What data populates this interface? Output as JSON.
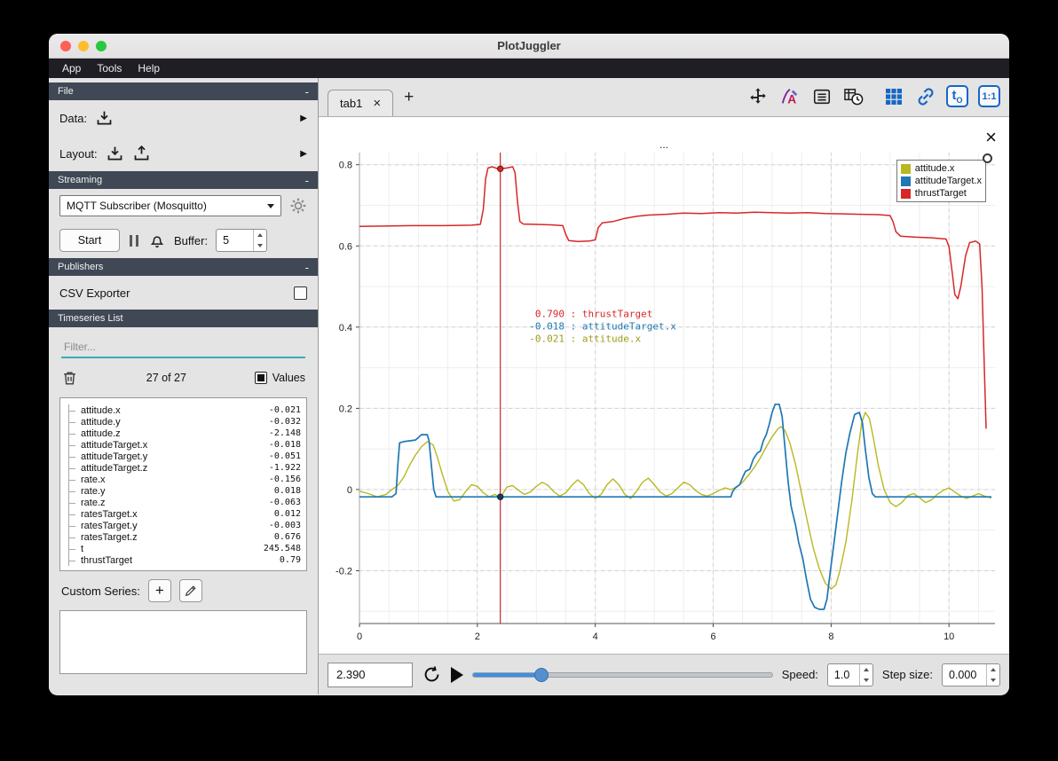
{
  "window": {
    "title": "PlotJuggler"
  },
  "menubar": {
    "items": [
      "App",
      "Tools",
      "Help"
    ]
  },
  "sidebar": {
    "file": {
      "title": "File",
      "collapse": "-",
      "data_label": "Data:",
      "layout_label": "Layout:"
    },
    "streaming": {
      "title": "Streaming",
      "collapse": "-",
      "source": "MQTT Subscriber (Mosquitto)",
      "start_label": "Start",
      "buffer_label": "Buffer:",
      "buffer_value": "5"
    },
    "publishers": {
      "title": "Publishers",
      "collapse": "-",
      "csv_label": "CSV Exporter"
    },
    "timeseries": {
      "title": "Timeseries List",
      "filter_placeholder": "Filter...",
      "count_label": "27 of 27",
      "values_label": "Values",
      "custom_series_label": "Custom Series:",
      "add_label": "+",
      "items": [
        {
          "name": "attitude.x",
          "value": "-0.021"
        },
        {
          "name": "attitude.y",
          "value": "-0.032"
        },
        {
          "name": "attitude.z",
          "value": "-2.148"
        },
        {
          "name": "attitudeTarget.x",
          "value": "-0.018"
        },
        {
          "name": "attitudeTarget.y",
          "value": "-0.051"
        },
        {
          "name": "attitudeTarget.z",
          "value": "-1.922"
        },
        {
          "name": "rate.x",
          "value": "-0.156"
        },
        {
          "name": "rate.y",
          "value": "0.018"
        },
        {
          "name": "rate.z",
          "value": "-0.063"
        },
        {
          "name": "ratesTarget.x",
          "value": "0.012"
        },
        {
          "name": "ratesTarget.y",
          "value": "-0.003"
        },
        {
          "name": "ratesTarget.z",
          "value": "0.676"
        },
        {
          "name": "t",
          "value": "245.548"
        },
        {
          "name": "thrustTarget",
          "value": "0.79"
        }
      ]
    }
  },
  "tabbar": {
    "tab_label": "tab1",
    "close_label": "×",
    "add_label": "+",
    "t0_label": "t",
    "t0_sub": "O",
    "ratio_label": "1:1"
  },
  "plot": {
    "title": "...",
    "close_label": "×"
  },
  "playback": {
    "time_value": "2.390",
    "speed_label": "Speed:",
    "speed_value": "1.0",
    "step_label": "Step size:",
    "step_value": "0.000",
    "slider_fraction": 0.23
  },
  "colors": {
    "accent_blue": "#1866c4",
    "tracker_red": "#c00000",
    "filter_underline": "#3aacb8",
    "series_yellow": "#b8b821",
    "series_blue": "#1f77b4",
    "series_red": "#d62728"
  },
  "chart_data": {
    "type": "line",
    "title": "...",
    "xlabel": "",
    "ylabel": "",
    "xlim": [
      0,
      10.78
    ],
    "ylim": [
      -0.33,
      0.83
    ],
    "grid": true,
    "legend_position": "top-right",
    "x_ticks": {
      "values": [
        0,
        2,
        4,
        6,
        8,
        10
      ],
      "labels": [
        "0",
        "2",
        "4",
        "6",
        "8",
        "10"
      ]
    },
    "y_ticks": {
      "values": [
        -0.2,
        0,
        0.2,
        0.4,
        0.6,
        0.8
      ],
      "labels": [
        "-0.2",
        "0",
        "0.2",
        "0.4",
        "0.6",
        "0.8"
      ]
    },
    "x_minor_step": 0.5,
    "y_minor_step": 0.1,
    "tracker": {
      "x": 2.39,
      "label_anchor": [
        2.88,
        0.425
      ],
      "lines": [
        {
          "value": " 0.790",
          "name": "thrustTarget",
          "color": "#d62728"
        },
        {
          "value": "-0.018",
          "name": "attitudeTarget.x",
          "color": "#1f77b4"
        },
        {
          "value": "-0.021",
          "name": "attitude.x",
          "color": "#9c9d1d"
        }
      ],
      "dots": [
        {
          "x": 2.39,
          "y": 0.79,
          "fill": "#d62728",
          "edge": "#7a1010"
        },
        {
          "x": 2.39,
          "y": -0.018,
          "fill": "#173a5e",
          "edge": "#0d2236"
        }
      ]
    },
    "series": [
      {
        "name": "attitude.x",
        "color": "#b8b821",
        "width": 1.4,
        "points": [
          [
            0,
            -0.004
          ],
          [
            0.15,
            -0.01
          ],
          [
            0.3,
            -0.018
          ],
          [
            0.45,
            -0.012
          ],
          [
            0.55,
            0
          ],
          [
            0.65,
            0.01
          ],
          [
            0.75,
            0.03
          ],
          [
            0.85,
            0.06
          ],
          [
            0.95,
            0.085
          ],
          [
            1.05,
            0.105
          ],
          [
            1.15,
            0.118
          ],
          [
            1.25,
            0.11
          ],
          [
            1.32,
            0.08
          ],
          [
            1.4,
            0.04
          ],
          [
            1.5,
            -0.005
          ],
          [
            1.6,
            -0.028
          ],
          [
            1.7,
            -0.025
          ],
          [
            1.8,
            -0.005
          ],
          [
            1.9,
            0.012
          ],
          [
            2.0,
            0.008
          ],
          [
            2.1,
            -0.008
          ],
          [
            2.2,
            -0.018
          ],
          [
            2.3,
            -0.012
          ],
          [
            2.39,
            -0.021
          ],
          [
            2.5,
            0.006
          ],
          [
            2.6,
            0.01
          ],
          [
            2.7,
            -0.002
          ],
          [
            2.8,
            -0.012
          ],
          [
            2.9,
            -0.006
          ],
          [
            3.0,
            0.008
          ],
          [
            3.1,
            0.018
          ],
          [
            3.2,
            0.01
          ],
          [
            3.3,
            -0.006
          ],
          [
            3.4,
            -0.016
          ],
          [
            3.5,
            -0.008
          ],
          [
            3.6,
            0.01
          ],
          [
            3.7,
            0.024
          ],
          [
            3.8,
            0.012
          ],
          [
            3.9,
            -0.01
          ],
          [
            4.0,
            -0.022
          ],
          [
            4.1,
            -0.012
          ],
          [
            4.2,
            0.012
          ],
          [
            4.3,
            0.026
          ],
          [
            4.4,
            0.012
          ],
          [
            4.5,
            -0.012
          ],
          [
            4.6,
            -0.022
          ],
          [
            4.7,
            -0.004
          ],
          [
            4.8,
            0.018
          ],
          [
            4.9,
            0.028
          ],
          [
            5.0,
            0.012
          ],
          [
            5.1,
            -0.006
          ],
          [
            5.2,
            -0.016
          ],
          [
            5.3,
            -0.01
          ],
          [
            5.4,
            0.004
          ],
          [
            5.5,
            0.018
          ],
          [
            5.6,
            0.012
          ],
          [
            5.7,
            -0.002
          ],
          [
            5.8,
            -0.012
          ],
          [
            5.9,
            -0.016
          ],
          [
            6.0,
            -0.01
          ],
          [
            6.1,
            -0.002
          ],
          [
            6.2,
            0.004
          ],
          [
            6.3,
            0
          ],
          [
            6.4,
            0.006
          ],
          [
            6.5,
            0.018
          ],
          [
            6.6,
            0.036
          ],
          [
            6.7,
            0.055
          ],
          [
            6.8,
            0.078
          ],
          [
            6.9,
            0.105
          ],
          [
            7.0,
            0.13
          ],
          [
            7.1,
            0.15
          ],
          [
            7.15,
            0.155
          ],
          [
            7.22,
            0.145
          ],
          [
            7.3,
            0.115
          ],
          [
            7.4,
            0.06
          ],
          [
            7.5,
            -0.01
          ],
          [
            7.6,
            -0.08
          ],
          [
            7.7,
            -0.145
          ],
          [
            7.8,
            -0.195
          ],
          [
            7.9,
            -0.23
          ],
          [
            8.0,
            -0.245
          ],
          [
            8.08,
            -0.235
          ],
          [
            8.15,
            -0.2
          ],
          [
            8.25,
            -0.13
          ],
          [
            8.35,
            -0.03
          ],
          [
            8.45,
            0.09
          ],
          [
            8.52,
            0.165
          ],
          [
            8.58,
            0.19
          ],
          [
            8.65,
            0.175
          ],
          [
            8.72,
            0.125
          ],
          [
            8.8,
            0.06
          ],
          [
            8.9,
            0
          ],
          [
            9.0,
            -0.032
          ],
          [
            9.1,
            -0.042
          ],
          [
            9.2,
            -0.032
          ],
          [
            9.3,
            -0.015
          ],
          [
            9.4,
            -0.01
          ],
          [
            9.5,
            -0.02
          ],
          [
            9.6,
            -0.032
          ],
          [
            9.7,
            -0.026
          ],
          [
            9.8,
            -0.012
          ],
          [
            9.9,
            -0.002
          ],
          [
            10.0,
            0.004
          ],
          [
            10.1,
            -0.006
          ],
          [
            10.2,
            -0.016
          ],
          [
            10.3,
            -0.022
          ],
          [
            10.4,
            -0.016
          ],
          [
            10.5,
            -0.01
          ],
          [
            10.6,
            -0.016
          ],
          [
            10.72,
            -0.021
          ]
        ]
      },
      {
        "name": "attitudeTarget.x",
        "color": "#1f77b4",
        "width": 1.7,
        "points": [
          [
            0,
            -0.018
          ],
          [
            0.55,
            -0.018
          ],
          [
            0.62,
            -0.01
          ],
          [
            0.65,
            0.06
          ],
          [
            0.68,
            0.115
          ],
          [
            0.75,
            0.118
          ],
          [
            0.85,
            0.12
          ],
          [
            0.95,
            0.122
          ],
          [
            1.0,
            0.128
          ],
          [
            1.05,
            0.135
          ],
          [
            1.15,
            0.135
          ],
          [
            1.18,
            0.12
          ],
          [
            1.22,
            0.06
          ],
          [
            1.26,
            0
          ],
          [
            1.3,
            -0.018
          ],
          [
            2.0,
            -0.018
          ],
          [
            3.0,
            -0.018
          ],
          [
            4.0,
            -0.018
          ],
          [
            5.0,
            -0.018
          ],
          [
            6.0,
            -0.018
          ],
          [
            6.3,
            -0.018
          ],
          [
            6.33,
            -0.005
          ],
          [
            6.38,
            0.005
          ],
          [
            6.45,
            0.012
          ],
          [
            6.5,
            0.03
          ],
          [
            6.55,
            0.045
          ],
          [
            6.62,
            0.05
          ],
          [
            6.68,
            0.075
          ],
          [
            6.75,
            0.09
          ],
          [
            6.8,
            0.095
          ],
          [
            6.85,
            0.12
          ],
          [
            6.9,
            0.135
          ],
          [
            6.95,
            0.16
          ],
          [
            7.0,
            0.19
          ],
          [
            7.05,
            0.21
          ],
          [
            7.12,
            0.21
          ],
          [
            7.17,
            0.18
          ],
          [
            7.22,
            0.1
          ],
          [
            7.27,
            0.02
          ],
          [
            7.32,
            -0.04
          ],
          [
            7.4,
            -0.09
          ],
          [
            7.45,
            -0.13
          ],
          [
            7.52,
            -0.17
          ],
          [
            7.58,
            -0.22
          ],
          [
            7.65,
            -0.27
          ],
          [
            7.72,
            -0.29
          ],
          [
            7.8,
            -0.295
          ],
          [
            7.88,
            -0.295
          ],
          [
            7.93,
            -0.27
          ],
          [
            7.98,
            -0.21
          ],
          [
            8.05,
            -0.13
          ],
          [
            8.12,
            -0.05
          ],
          [
            8.18,
            0.02
          ],
          [
            8.25,
            0.09
          ],
          [
            8.32,
            0.14
          ],
          [
            8.4,
            0.185
          ],
          [
            8.48,
            0.19
          ],
          [
            8.53,
            0.165
          ],
          [
            8.58,
            0.1
          ],
          [
            8.64,
            0.03
          ],
          [
            8.7,
            -0.01
          ],
          [
            8.75,
            -0.018
          ],
          [
            9.5,
            -0.018
          ],
          [
            10.3,
            -0.018
          ],
          [
            10.72,
            -0.018
          ]
        ]
      },
      {
        "name": "thrustTarget",
        "color": "#d62728",
        "width": 1.5,
        "points": [
          [
            0,
            0.648
          ],
          [
            0.4,
            0.649
          ],
          [
            0.9,
            0.65
          ],
          [
            1.4,
            0.65
          ],
          [
            1.9,
            0.651
          ],
          [
            2.05,
            0.653
          ],
          [
            2.1,
            0.69
          ],
          [
            2.14,
            0.765
          ],
          [
            2.18,
            0.792
          ],
          [
            2.25,
            0.795
          ],
          [
            2.35,
            0.79
          ],
          [
            2.39,
            0.79
          ],
          [
            2.5,
            0.792
          ],
          [
            2.6,
            0.795
          ],
          [
            2.64,
            0.78
          ],
          [
            2.68,
            0.71
          ],
          [
            2.72,
            0.66
          ],
          [
            2.78,
            0.654
          ],
          [
            3.0,
            0.653
          ],
          [
            3.25,
            0.652
          ],
          [
            3.45,
            0.65
          ],
          [
            3.5,
            0.628
          ],
          [
            3.55,
            0.613
          ],
          [
            3.7,
            0.611
          ],
          [
            3.9,
            0.612
          ],
          [
            4.0,
            0.615
          ],
          [
            4.05,
            0.645
          ],
          [
            4.12,
            0.657
          ],
          [
            4.3,
            0.66
          ],
          [
            4.5,
            0.668
          ],
          [
            4.7,
            0.673
          ],
          [
            4.9,
            0.676
          ],
          [
            5.2,
            0.678
          ],
          [
            5.5,
            0.681
          ],
          [
            5.8,
            0.68
          ],
          [
            6.1,
            0.682
          ],
          [
            6.4,
            0.681
          ],
          [
            6.7,
            0.683
          ],
          [
            7.0,
            0.682
          ],
          [
            7.3,
            0.681
          ],
          [
            7.6,
            0.682
          ],
          [
            7.9,
            0.68
          ],
          [
            8.2,
            0.679
          ],
          [
            8.5,
            0.678
          ],
          [
            8.8,
            0.677
          ],
          [
            9.0,
            0.675
          ],
          [
            9.05,
            0.66
          ],
          [
            9.1,
            0.635
          ],
          [
            9.18,
            0.624
          ],
          [
            9.4,
            0.622
          ],
          [
            9.7,
            0.62
          ],
          [
            9.95,
            0.617
          ],
          [
            10.0,
            0.598
          ],
          [
            10.05,
            0.54
          ],
          [
            10.1,
            0.48
          ],
          [
            10.15,
            0.47
          ],
          [
            10.2,
            0.5
          ],
          [
            10.28,
            0.575
          ],
          [
            10.35,
            0.608
          ],
          [
            10.45,
            0.612
          ],
          [
            10.52,
            0.605
          ],
          [
            10.56,
            0.5
          ],
          [
            10.6,
            0.3
          ],
          [
            10.63,
            0.15
          ]
        ]
      }
    ]
  }
}
